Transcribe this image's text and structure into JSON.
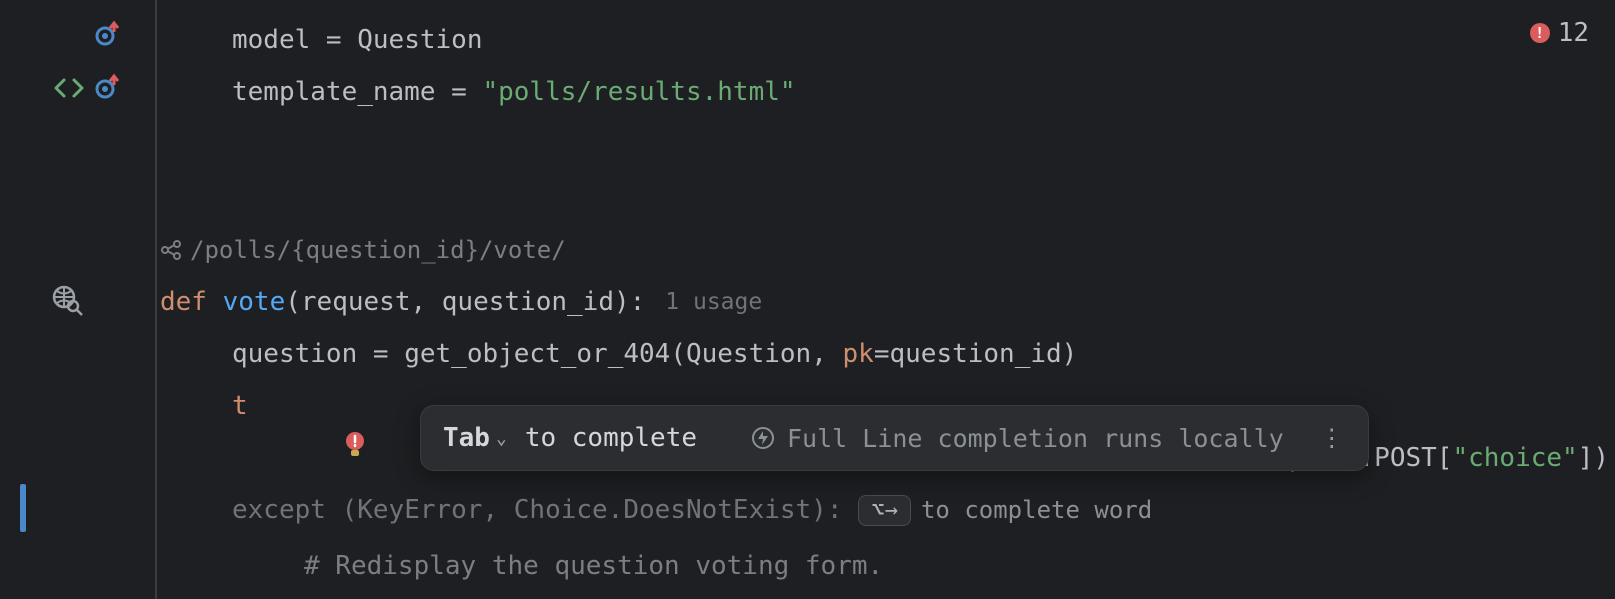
{
  "errors": {
    "count": "12"
  },
  "gutter": {
    "icon1": "override-up-icon",
    "icon2": "code-tag-icon",
    "icon3": "override-up-icon",
    "icon4": "web-search-icon",
    "bulb": "intention-bulb-icon"
  },
  "code": {
    "l0": {
      "lhs": "model",
      "eq": " = ",
      "rhs": "Question"
    },
    "l1": {
      "lhs": "template_name",
      "eq": " = ",
      "rhs": "\"polls/results.html\""
    },
    "route": "/polls/{question_id}/vote/",
    "l5": {
      "def": "def ",
      "name": "vote",
      "params": "(request, question_id):",
      "usage": "1 usage"
    },
    "l6": {
      "lhs": "question",
      "eq": " = ",
      "fn": "get_object_or_404",
      "open": "(",
      "arg1": "Question",
      "comma": ", ",
      "kw": "pk",
      "kweq": "=",
      "kwval": "question_id",
      "close": ")"
    },
    "l7": {
      "t": "t"
    },
    "l7b_tail": {
      "pre": "request.POST[",
      "str": "\"choice\"",
      "post": "])"
    },
    "l8": {
      "kw": "except ",
      "args": "(KeyError, Choice.DoesNotExist):",
      "keycap": "⌥→",
      "hint": "to complete word"
    },
    "l9": {
      "cmt": "# Redisplay the question voting form."
    }
  },
  "popup": {
    "tab": "Tab",
    "to_complete": "to complete",
    "info": "Full Line completion runs locally"
  }
}
